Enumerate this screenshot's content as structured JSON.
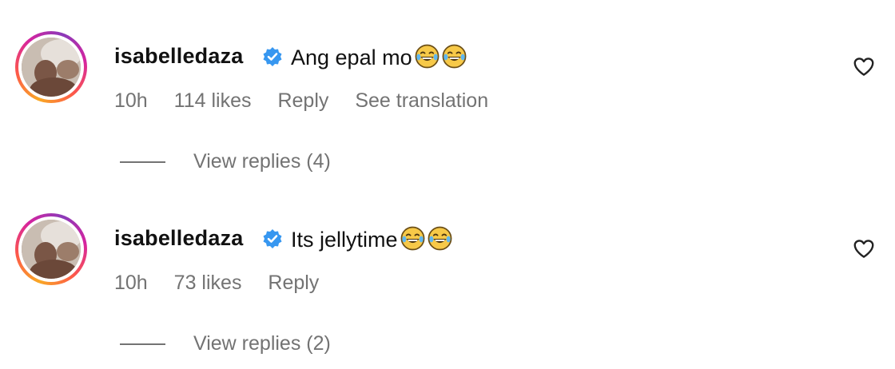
{
  "comments": [
    {
      "username": "isabelledaza",
      "verified": true,
      "text": "Ang epal mo",
      "emojis": [
        "face-with-tears-of-joy-icon",
        "face-with-tears-of-joy-icon"
      ],
      "time": "10h",
      "likes": "114 likes",
      "reply": "Reply",
      "translate": "See translation",
      "view_replies": "View replies (4)"
    },
    {
      "username": "isabelledaza",
      "verified": true,
      "text": "Its jellytime",
      "emojis": [
        "face-with-tears-of-joy-icon",
        "face-with-tears-of-joy-icon"
      ],
      "time": "10h",
      "likes": "73 likes",
      "reply": "Reply",
      "view_replies": "View replies (2)"
    }
  ],
  "colors": {
    "verified_badge": "#3797f0",
    "meta_text": "#737373",
    "text": "#111111"
  }
}
